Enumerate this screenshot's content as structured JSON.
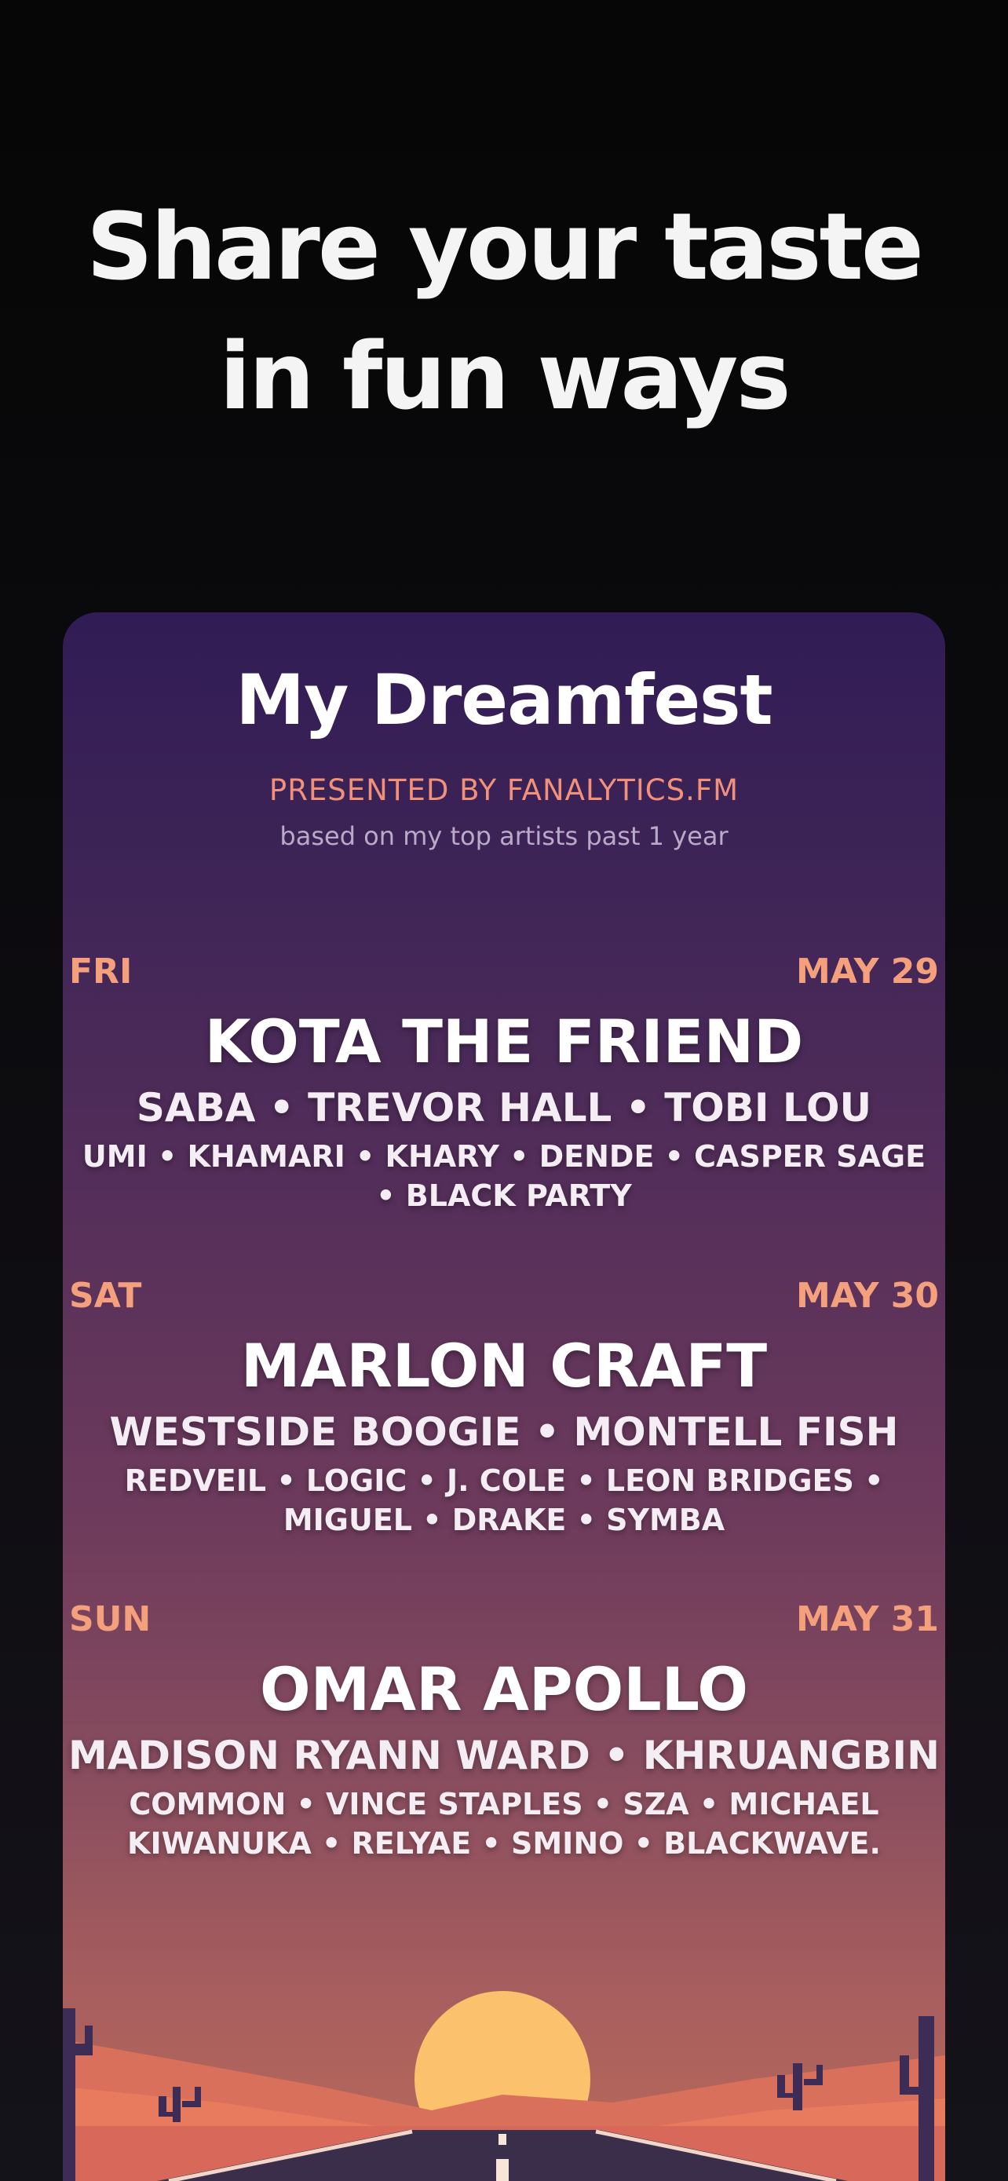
{
  "headline": {
    "line1": "Share your taste",
    "line2": "in fun ways"
  },
  "card": {
    "title": "My Dreamfest",
    "presented_by": "PRESENTED BY FANALYTICS.FM",
    "based_on": "based on my top artists past 1 year",
    "days": [
      {
        "day": "FRI",
        "date": "MAY 29",
        "headliner": "KOTA THE FRIEND",
        "second_tier": "SABA • TREVOR HALL • TOBI LOU",
        "third_tier": "UMI • KHAMARI • KHARY • DENDE • CASPER SAGE • BLACK PARTY"
      },
      {
        "day": "SAT",
        "date": "MAY 30",
        "headliner": "MARLON CRAFT",
        "second_tier": "WESTSIDE BOOGIE • MONTELL FISH",
        "third_tier": "REDVEIL • LOGIC • J. COLE • LEON BRIDGES • MIGUEL • DRAKE • SYMBA"
      },
      {
        "day": "SUN",
        "date": "MAY 31",
        "headliner": "OMAR APOLLO",
        "second_tier": "MADISON RYANN WARD • KHRUANGBIN",
        "third_tier": "COMMON • VINCE STAPLES • SZA • MICHAEL KIWANUKA • RELYAE • SMINO • BLACKWAVE."
      }
    ],
    "colors": {
      "accent": "#f5a07c",
      "sun": "#fbc16c",
      "road": "#3a2e4a"
    }
  }
}
